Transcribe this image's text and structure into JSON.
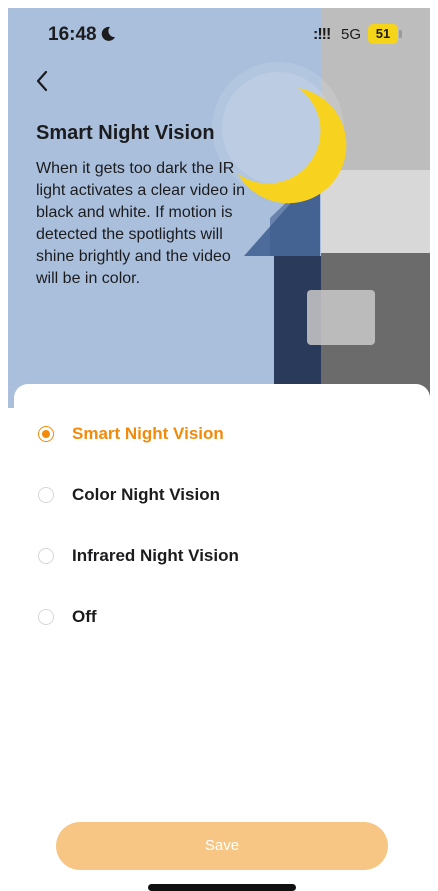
{
  "status_bar": {
    "time": "16:48",
    "signal": ":!!!",
    "network": "5G",
    "battery": "51"
  },
  "hero": {
    "title": "Smart Night Vision",
    "description": "When it gets too dark the IR light activates a clear video in black and white. If motion is detected the spotlights will shine brightly and the video will be in color."
  },
  "options": [
    {
      "label": "Smart Night Vision",
      "selected": true
    },
    {
      "label": "Color Night Vision",
      "selected": false
    },
    {
      "label": "Infrared Night Vision",
      "selected": false
    },
    {
      "label": "Off",
      "selected": false
    }
  ],
  "save_label": "Save",
  "colors": {
    "accent": "#f28a0a",
    "save_button": "#f7c685",
    "hero_sky": "#a9bfdc"
  }
}
